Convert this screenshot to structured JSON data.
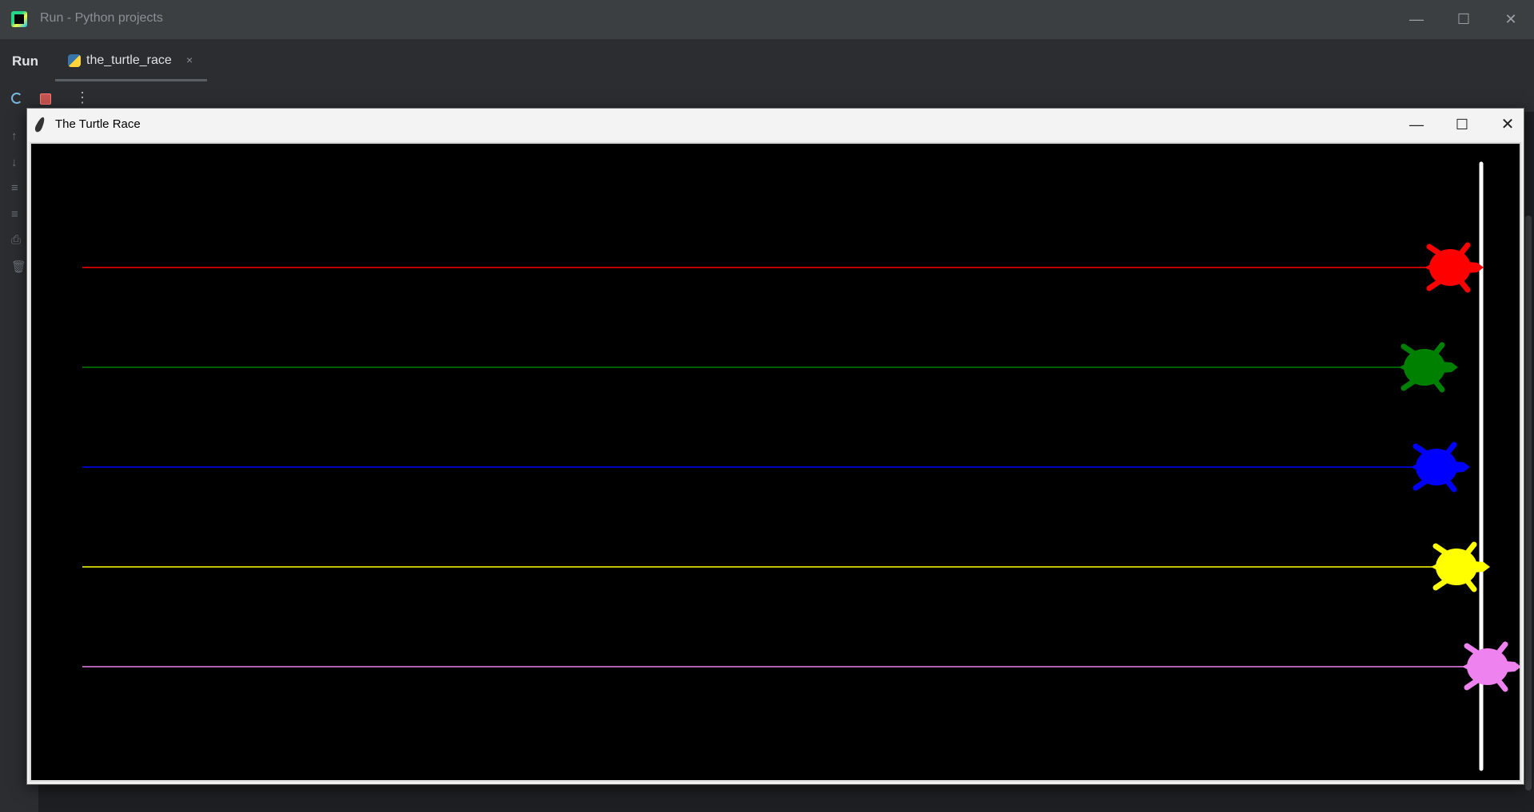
{
  "ide": {
    "window_title": "Run - Python projects",
    "controls": {
      "minimize": "—",
      "maximize": "☐",
      "close": "✕"
    }
  },
  "run_panel": {
    "label": "Run",
    "tab_label": "the_turtle_race",
    "tab_close": "×",
    "toolbar": {
      "more": "⋮"
    }
  },
  "gutter_icons": [
    "arrow-up-icon",
    "arrow-down-icon",
    "soft-wrap-icon",
    "scroll-to-end-icon",
    "print-icon",
    "trash-icon"
  ],
  "turtle_window": {
    "title": "The Turtle Race",
    "controls": {
      "minimize": "—",
      "maximize": "☐",
      "close": "✕"
    },
    "canvas_background": "#000000",
    "finish_line_color": "#ffffff",
    "turtles": [
      {
        "color": "red",
        "hex": "#ff0000"
      },
      {
        "color": "green",
        "hex": "#008000"
      },
      {
        "color": "blue",
        "hex": "#0000ff"
      },
      {
        "color": "yellow",
        "hex": "#ffff00"
      },
      {
        "color": "violet",
        "hex": "#ee82ee"
      }
    ]
  }
}
